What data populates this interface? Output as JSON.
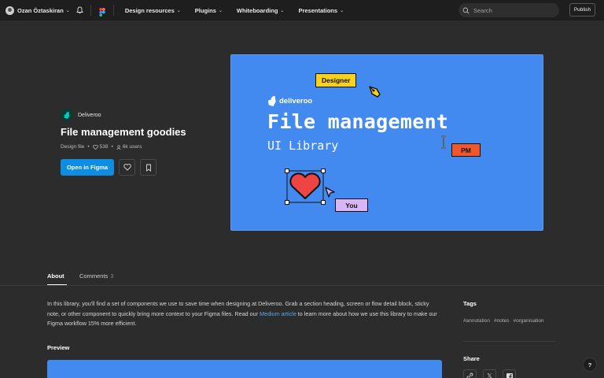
{
  "nav": {
    "user_name": "Ozan Öztaskiran",
    "links": [
      "Design resources",
      "Plugins",
      "Whiteboarding",
      "Presentations"
    ],
    "search_placeholder": "Search",
    "publish_label": "Publish"
  },
  "file": {
    "brand": "Deliveroo",
    "title": "File management goodies",
    "type": "Design file",
    "likes": "538",
    "users": "6k users",
    "open_button": "Open in Figma"
  },
  "cover": {
    "tag_designer": "Designer",
    "logo_text": "deliveroo",
    "title": "File management",
    "subtitle": "UI Library",
    "tag_pm": "PM",
    "tag_you": "You",
    "colors": {
      "background": "#4289f0",
      "designer": "#f8d21c",
      "pm": "#f0572b",
      "you": "#d8b6f5",
      "heart": "#ef4444"
    }
  },
  "tabs": {
    "about": "About",
    "comments": "Comments",
    "comments_count": "3"
  },
  "about": {
    "desc_before": "In this library, you'll find a set of components we use to save time when designing at Deliveroo. Grab a section heading, screen or flow detail block, sticky note, or other component to quickly bring more context to your Figma files. Read our ",
    "desc_link": "Medium article",
    "desc_after": " to learn more about how we use this library to make our Figma workflow 15% more efficient.",
    "preview_label": "Preview"
  },
  "sidebar": {
    "tags_label": "Tags",
    "tags": [
      "#annotation",
      "#notes",
      "#organisation"
    ],
    "share_label": "Share"
  },
  "help_label": "?",
  "colors": {
    "accent": "#0d8de3",
    "link": "#5aa7ef",
    "background": "#2c2c2c",
    "topbar": "#1e1e1e"
  }
}
